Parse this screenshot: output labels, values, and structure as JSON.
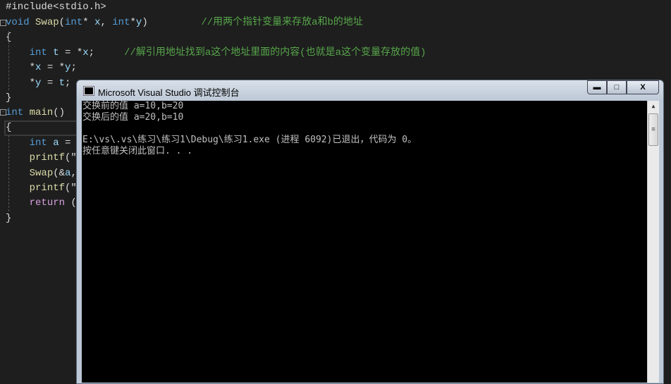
{
  "editor": {
    "lines": [
      {
        "parts": [
          [
            "t",
            "#include<stdio.h>"
          ]
        ]
      },
      {
        "parts": [
          [
            "kw",
            "void "
          ],
          [
            "fn",
            "Swap"
          ],
          [
            "t",
            "("
          ],
          [
            "kw",
            "int"
          ],
          [
            "t",
            "* "
          ],
          [
            "vr",
            "x"
          ],
          [
            "t",
            ", "
          ],
          [
            "kw",
            "int"
          ],
          [
            "t",
            "*"
          ],
          [
            "vr",
            "y"
          ],
          [
            "t",
            ")         "
          ],
          [
            "cm",
            "//用两个指针变量来存放a和b的地址"
          ]
        ]
      },
      {
        "parts": [
          [
            "t",
            "{"
          ]
        ]
      },
      {
        "parts": [
          [
            "t",
            "    "
          ],
          [
            "kw",
            "int "
          ],
          [
            "vr",
            "t"
          ],
          [
            "t",
            " = *"
          ],
          [
            "vr",
            "x"
          ],
          [
            "t",
            ";     "
          ],
          [
            "cm",
            "//解引用地址找到a这个地址里面的内容(也就是a这个变量存放的值)"
          ]
        ]
      },
      {
        "parts": [
          [
            "t",
            "    *"
          ],
          [
            "vr",
            "x"
          ],
          [
            "t",
            " = *"
          ],
          [
            "vr",
            "y"
          ],
          [
            "t",
            ";"
          ]
        ]
      },
      {
        "parts": [
          [
            "t",
            "    *"
          ],
          [
            "vr",
            "y"
          ],
          [
            "t",
            " = "
          ],
          [
            "vr",
            "t"
          ],
          [
            "t",
            ";"
          ]
        ]
      },
      {
        "parts": [
          [
            "t",
            "}"
          ]
        ]
      },
      {
        "parts": [
          [
            "kw",
            "int "
          ],
          [
            "fn",
            "main"
          ],
          [
            "t",
            "()"
          ]
        ]
      },
      {
        "parts": [
          [
            "t",
            "{"
          ]
        ]
      },
      {
        "parts": [
          [
            "t",
            "    "
          ],
          [
            "kw",
            "int "
          ],
          [
            "vr",
            "a"
          ],
          [
            "t",
            " ="
          ]
        ]
      },
      {
        "parts": [
          [
            "t",
            "    "
          ],
          [
            "fn",
            "printf"
          ],
          [
            "t",
            "(\""
          ]
        ]
      },
      {
        "parts": [
          [
            "t",
            "    "
          ],
          [
            "fn",
            "Swap"
          ],
          [
            "t",
            "(&"
          ],
          [
            "vr",
            "a"
          ],
          [
            "t",
            ","
          ]
        ]
      },
      {
        "parts": [
          [
            "t",
            "    "
          ],
          [
            "fn",
            "printf"
          ],
          [
            "t",
            "(\""
          ]
        ]
      },
      {
        "parts": [
          [
            "t",
            "    "
          ],
          [
            "rt",
            "return"
          ],
          [
            "t",
            " ("
          ]
        ]
      },
      {
        "parts": [
          [
            "t",
            "}"
          ]
        ]
      }
    ]
  },
  "console": {
    "title": "Microsoft Visual Studio 调试控制台",
    "buttons": {
      "minimize": "▬",
      "maximize": "□",
      "close": "X"
    },
    "output": [
      "交换前的值 a=10,b=20",
      "交换后的值 a=20,b=10",
      "",
      "E:\\vs\\.vs\\练习\\练习1\\Debug\\练习1.exe (进程 6092)已退出，代码为 0。",
      "按任意键关闭此窗口. . ."
    ]
  }
}
